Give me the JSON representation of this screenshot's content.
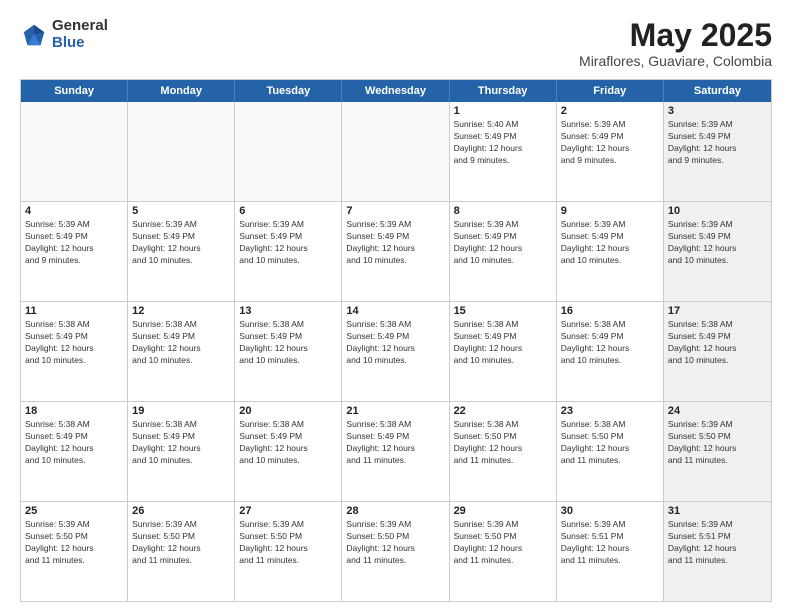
{
  "logo": {
    "general": "General",
    "blue": "Blue"
  },
  "header": {
    "title": "May 2025",
    "subtitle": "Miraflores, Guaviare, Colombia"
  },
  "weekdays": [
    "Sunday",
    "Monday",
    "Tuesday",
    "Wednesday",
    "Thursday",
    "Friday",
    "Saturday"
  ],
  "rows": [
    [
      {
        "day": "",
        "info": "",
        "empty": true
      },
      {
        "day": "",
        "info": "",
        "empty": true
      },
      {
        "day": "",
        "info": "",
        "empty": true
      },
      {
        "day": "",
        "info": "",
        "empty": true
      },
      {
        "day": "1",
        "info": "Sunrise: 5:40 AM\nSunset: 5:49 PM\nDaylight: 12 hours\nand 9 minutes."
      },
      {
        "day": "2",
        "info": "Sunrise: 5:39 AM\nSunset: 5:49 PM\nDaylight: 12 hours\nand 9 minutes."
      },
      {
        "day": "3",
        "info": "Sunrise: 5:39 AM\nSunset: 5:49 PM\nDaylight: 12 hours\nand 9 minutes.",
        "shaded": true
      }
    ],
    [
      {
        "day": "4",
        "info": "Sunrise: 5:39 AM\nSunset: 5:49 PM\nDaylight: 12 hours\nand 9 minutes."
      },
      {
        "day": "5",
        "info": "Sunrise: 5:39 AM\nSunset: 5:49 PM\nDaylight: 12 hours\nand 10 minutes."
      },
      {
        "day": "6",
        "info": "Sunrise: 5:39 AM\nSunset: 5:49 PM\nDaylight: 12 hours\nand 10 minutes."
      },
      {
        "day": "7",
        "info": "Sunrise: 5:39 AM\nSunset: 5:49 PM\nDaylight: 12 hours\nand 10 minutes."
      },
      {
        "day": "8",
        "info": "Sunrise: 5:39 AM\nSunset: 5:49 PM\nDaylight: 12 hours\nand 10 minutes."
      },
      {
        "day": "9",
        "info": "Sunrise: 5:39 AM\nSunset: 5:49 PM\nDaylight: 12 hours\nand 10 minutes."
      },
      {
        "day": "10",
        "info": "Sunrise: 5:39 AM\nSunset: 5:49 PM\nDaylight: 12 hours\nand 10 minutes.",
        "shaded": true
      }
    ],
    [
      {
        "day": "11",
        "info": "Sunrise: 5:38 AM\nSunset: 5:49 PM\nDaylight: 12 hours\nand 10 minutes."
      },
      {
        "day": "12",
        "info": "Sunrise: 5:38 AM\nSunset: 5:49 PM\nDaylight: 12 hours\nand 10 minutes."
      },
      {
        "day": "13",
        "info": "Sunrise: 5:38 AM\nSunset: 5:49 PM\nDaylight: 12 hours\nand 10 minutes."
      },
      {
        "day": "14",
        "info": "Sunrise: 5:38 AM\nSunset: 5:49 PM\nDaylight: 12 hours\nand 10 minutes."
      },
      {
        "day": "15",
        "info": "Sunrise: 5:38 AM\nSunset: 5:49 PM\nDaylight: 12 hours\nand 10 minutes."
      },
      {
        "day": "16",
        "info": "Sunrise: 5:38 AM\nSunset: 5:49 PM\nDaylight: 12 hours\nand 10 minutes."
      },
      {
        "day": "17",
        "info": "Sunrise: 5:38 AM\nSunset: 5:49 PM\nDaylight: 12 hours\nand 10 minutes.",
        "shaded": true
      }
    ],
    [
      {
        "day": "18",
        "info": "Sunrise: 5:38 AM\nSunset: 5:49 PM\nDaylight: 12 hours\nand 10 minutes."
      },
      {
        "day": "19",
        "info": "Sunrise: 5:38 AM\nSunset: 5:49 PM\nDaylight: 12 hours\nand 10 minutes."
      },
      {
        "day": "20",
        "info": "Sunrise: 5:38 AM\nSunset: 5:49 PM\nDaylight: 12 hours\nand 10 minutes."
      },
      {
        "day": "21",
        "info": "Sunrise: 5:38 AM\nSunset: 5:49 PM\nDaylight: 12 hours\nand 11 minutes."
      },
      {
        "day": "22",
        "info": "Sunrise: 5:38 AM\nSunset: 5:50 PM\nDaylight: 12 hours\nand 11 minutes."
      },
      {
        "day": "23",
        "info": "Sunrise: 5:38 AM\nSunset: 5:50 PM\nDaylight: 12 hours\nand 11 minutes."
      },
      {
        "day": "24",
        "info": "Sunrise: 5:39 AM\nSunset: 5:50 PM\nDaylight: 12 hours\nand 11 minutes.",
        "shaded": true
      }
    ],
    [
      {
        "day": "25",
        "info": "Sunrise: 5:39 AM\nSunset: 5:50 PM\nDaylight: 12 hours\nand 11 minutes."
      },
      {
        "day": "26",
        "info": "Sunrise: 5:39 AM\nSunset: 5:50 PM\nDaylight: 12 hours\nand 11 minutes."
      },
      {
        "day": "27",
        "info": "Sunrise: 5:39 AM\nSunset: 5:50 PM\nDaylight: 12 hours\nand 11 minutes."
      },
      {
        "day": "28",
        "info": "Sunrise: 5:39 AM\nSunset: 5:50 PM\nDaylight: 12 hours\nand 11 minutes."
      },
      {
        "day": "29",
        "info": "Sunrise: 5:39 AM\nSunset: 5:50 PM\nDaylight: 12 hours\nand 11 minutes."
      },
      {
        "day": "30",
        "info": "Sunrise: 5:39 AM\nSunset: 5:51 PM\nDaylight: 12 hours\nand 11 minutes."
      },
      {
        "day": "31",
        "info": "Sunrise: 5:39 AM\nSunset: 5:51 PM\nDaylight: 12 hours\nand 11 minutes.",
        "shaded": true
      }
    ]
  ]
}
